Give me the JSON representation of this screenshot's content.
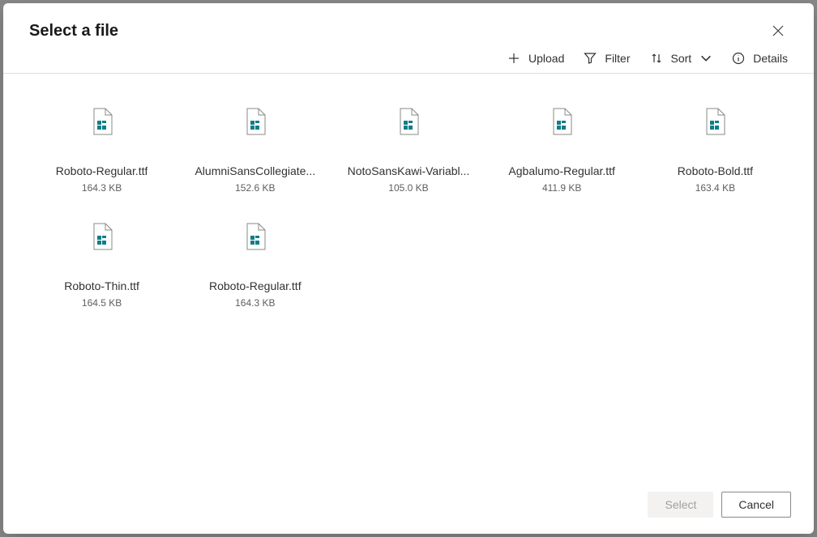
{
  "dialog": {
    "title": "Select a file",
    "toolbar": {
      "upload": "Upload",
      "filter": "Filter",
      "sort": "Sort",
      "details": "Details"
    },
    "footer": {
      "select": "Select",
      "cancel": "Cancel"
    }
  },
  "files": [
    {
      "name": "Roboto-Regular.ttf",
      "size": "164.3 KB"
    },
    {
      "name": "AlumniSansCollegiate...",
      "size": "152.6 KB"
    },
    {
      "name": "NotoSansKawi-Variabl...",
      "size": "105.0 KB"
    },
    {
      "name": "Agbalumo-Regular.ttf",
      "size": "411.9 KB"
    },
    {
      "name": "Roboto-Bold.ttf",
      "size": "163.4 KB"
    },
    {
      "name": "Roboto-Thin.ttf",
      "size": "164.5 KB"
    },
    {
      "name": "Roboto-Regular.ttf",
      "size": "164.3 KB"
    }
  ]
}
